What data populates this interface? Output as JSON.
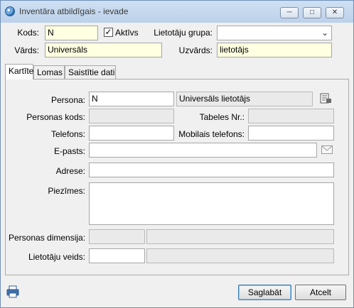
{
  "window": {
    "title": "Inventāra atbildīgais - ievade"
  },
  "header": {
    "kods_label": "Kods:",
    "kods_value": "N",
    "aktivs_label": "Aktīvs",
    "aktivs_checked": "✓",
    "grupa_label": "Lietotāju grupa:",
    "grupa_value": "",
    "vards_label": "Vārds:",
    "vards_value": "Universāls",
    "uzvards_label": "Uzvārds:",
    "uzvards_value": "lietotājs"
  },
  "tabs": [
    "Kartīte",
    "Lomas",
    "Saistītie dati"
  ],
  "form": {
    "persona_label": "Persona:",
    "persona_code": "N",
    "persona_name": "Universāls lietotājs",
    "personas_kods_label": "Personas kods:",
    "personas_kods_value": "",
    "tabeles_label": "Tabeles Nr.:",
    "tabeles_value": "",
    "telefons_label": "Telefons:",
    "telefons_value": "",
    "mobilais_label": "Mobilais telefons:",
    "mobilais_value": "",
    "epasts_label": "E-pasts:",
    "epasts_value": "",
    "adrese_label": "Adrese:",
    "adrese_value": "",
    "piezimes_label": "Piezīmes:",
    "piezimes_value": "",
    "dimensija_label": "Personas dimensija:",
    "dimensija_code": "",
    "dimensija_name": "",
    "veids_label": "Lietotāju veids:",
    "veids_code": "",
    "veids_name": ""
  },
  "footer": {
    "save_label": "Saglabāt",
    "cancel_label": "Atcelt"
  },
  "icons": {
    "app": "globe-icon",
    "lookup": "document-lookup-icon",
    "mail": "envelope-icon",
    "print": "printer-icon"
  }
}
